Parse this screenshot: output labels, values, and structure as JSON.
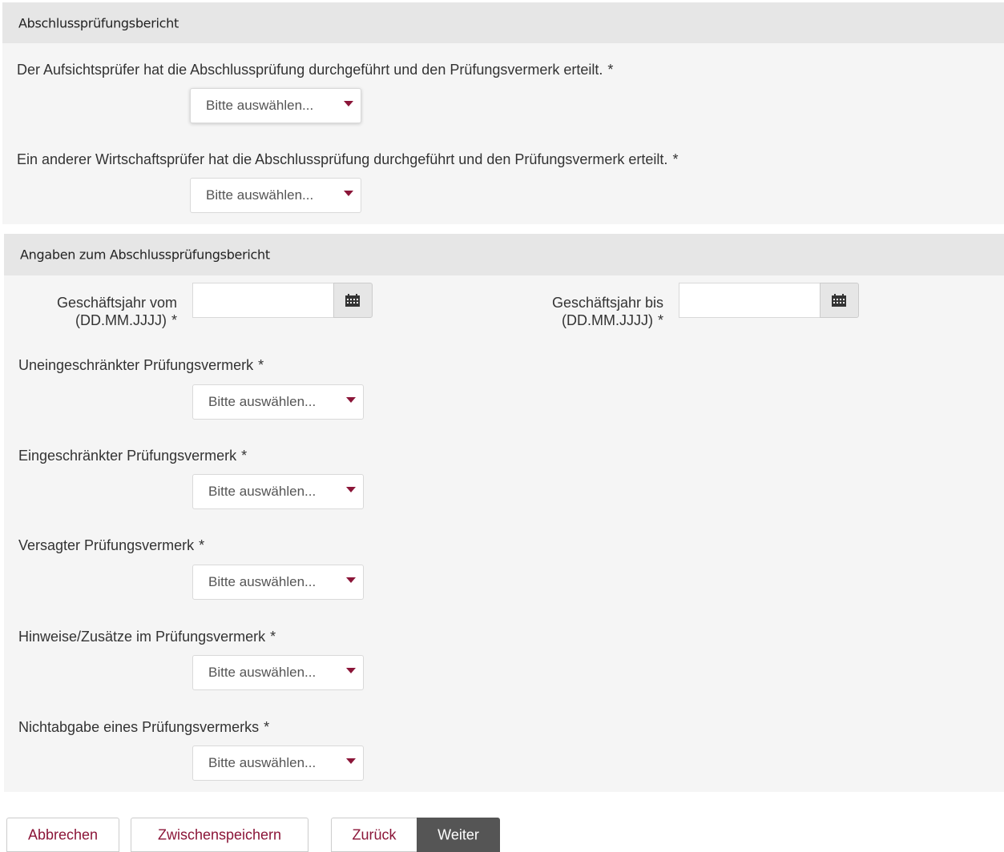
{
  "section1": {
    "title": "Abschlussprüfungsbericht",
    "q1": {
      "label": "Der Aufsichtsprüfer hat die Abschlussprüfung durchgeführt und den Prüfungsvermerk erteilt.",
      "required": "*",
      "value": "Bitte auswählen..."
    },
    "q2": {
      "label": "Ein anderer Wirtschaftsprüfer hat die Abschlussprüfung durchgeführt und den Prüfungsvermerk erteilt.",
      "required": "*",
      "value": "Bitte auswählen..."
    }
  },
  "section2": {
    "title": "Angaben zum Abschlussprüfungsbericht",
    "date_from": {
      "label_line1": "Geschäftsjahr vom",
      "label_line2": "(DD.MM.JJJJ)",
      "required": "*",
      "value": ""
    },
    "date_to": {
      "label_line1": "Geschäftsjahr bis",
      "label_line2": "(DD.MM.JJJJ)",
      "required": "*",
      "value": ""
    },
    "q3": {
      "label": "Uneingeschränkter Prüfungsvermerk",
      "required": "*",
      "value": "Bitte auswählen..."
    },
    "q4": {
      "label": "Eingeschränkter Prüfungsvermerk",
      "required": "*",
      "value": "Bitte auswählen..."
    },
    "q5": {
      "label": "Versagter Prüfungsvermerk",
      "required": "*",
      "value": "Bitte auswählen..."
    },
    "q6": {
      "label": "Hinweise/Zusätze im Prüfungsvermerk",
      "required": "*",
      "value": "Bitte auswählen..."
    },
    "q7": {
      "label": "Nichtabgabe eines Prüfungsvermerks",
      "required": "*",
      "value": "Bitte auswählen..."
    }
  },
  "footer": {
    "cancel_label": "Abbrechen",
    "save_label": "Zwischenspeichern",
    "back_label": "Zurück",
    "next_label": "Weiter"
  },
  "icons": {
    "calendar": "calendar-icon",
    "dropdown": "caret-down-icon"
  },
  "colors": {
    "accent": "#8b1538",
    "panel": "#f5f5f5",
    "header": "#e6e6e6",
    "primary_button": "#555555"
  }
}
